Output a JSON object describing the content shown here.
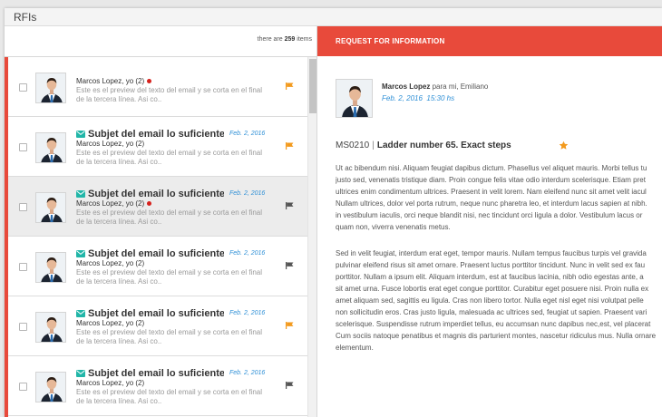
{
  "window": {
    "title": "RFIs"
  },
  "list": {
    "count_prefix": "there are",
    "count_value": "259",
    "count_suffix": "items"
  },
  "messages": [
    {
      "subject": "",
      "date": "",
      "from": "Marcos Lopez, yo (2)",
      "unread_dot": true,
      "preview": "Este es el preview del texto del email y se corta en el final de la tercera línea. Asi co..",
      "flag_color": "#f39a1d",
      "selected": false
    },
    {
      "subject": "Subjet del email lo suficientem..",
      "date": "Feb. 2, 2016",
      "from": "Marcos Lopez, yo (2)",
      "unread_dot": false,
      "preview": "Este es el preview del texto del email y se corta en el final de la tercera línea. Asi co..",
      "flag_color": "#f39a1d",
      "selected": false
    },
    {
      "subject": "Subjet del email lo suficientem..",
      "date": "Feb. 2, 2016",
      "from": "Marcos Lopez, yo (2)",
      "unread_dot": true,
      "preview": "Este es el preview del texto del email y se corta en el final de la tercera línea. Asi co..",
      "flag_color": "#555555",
      "selected": true
    },
    {
      "subject": "Subjet del email lo suficientem..",
      "date": "Feb. 2, 2016",
      "from": "Marcos Lopez, yo (2)",
      "unread_dot": false,
      "preview": "Este es el preview del texto del email y se corta en el final de la tercera línea. Asi co..",
      "flag_color": "#555555",
      "selected": false
    },
    {
      "subject": "Subjet del email lo suficientem..",
      "date": "Feb. 2, 2016",
      "from": "Marcos Lopez, yo (2)",
      "unread_dot": false,
      "preview": "Este es el preview del texto del email y se corta en el final de la tercera línea. Asi co..",
      "flag_color": "#f39a1d",
      "selected": false
    },
    {
      "subject": "Subjet del email lo suficientem..",
      "date": "Feb. 2, 2016",
      "from": "Marcos Lopez, yo (2)",
      "unread_dot": false,
      "preview": "Este es el preview del texto del email y se corta en el final de la tercera línea. Asi co..",
      "flag_color": "#555555",
      "selected": false
    }
  ],
  "detail": {
    "header": "REQUEST FOR INFORMATION",
    "sender": "Marcos Lopez",
    "recipients": "para mi, Emiliano",
    "date": "Feb. 2, 2016",
    "time": "15:30 hs",
    "code": "MS0210",
    "separator": "|",
    "title": "Ladder number 65. Exact steps",
    "starred": true,
    "paragraph1_lines": [
      "Ut ac bibendum nisi. Aliquam feugiat dapibus dictum. Phasellus vel aliquet mauris. Morbi tellus tu",
      "justo sed, venenatis tristique diam. Proin congue felis vitae odio interdum scelerisque. Etiam pret",
      "ultrices enim condimentum ultrices. Praesent in velit lorem. Nam eleifend nunc sit amet velit iacul",
      "Nullam ultrices, dolor vel porta rutrum, neque nunc pharetra leo, et interdum lacus sapien at nibh.",
      "in vestibulum iaculis, orci neque blandit nisi, nec tincidunt orci ligula a dolor. Vestibulum lacus or",
      "quam non, viverra venenatis metus."
    ],
    "paragraph2_lines": [
      "Sed in velit feugiat, interdum erat eget, tempor mauris. Nullam tempus faucibus turpis vel gravida",
      "pulvinar eleifend risus sit amet ornare. Praesent luctus porttitor tincidunt. Nunc in velit sed ex fau",
      "porttitor. Nullam a ipsum elit. Aliquam interdum, est at faucibus lacinia, nibh odio egestas ante, a",
      "sit amet urna. Fusce lobortis erat eget congue porttitor. Curabitur eget posuere nisi. Proin nulla ex",
      "amet aliquam sed, sagittis eu ligula. Cras non libero tortor. Nulla eget nisl eget nisi volutpat pelle",
      "non sollicitudin eros. Cras justo ligula, malesuada ac ultrices sed, feugiat ut sapien. Praesent vari",
      "scelerisque. Suspendisse rutrum imperdiet tellus, eu accumsan nunc dapibus nec,est, vel placerat",
      "Cum sociis natoque penatibus et magnis dis parturient montes, nascetur ridiculus mus. Nulla ornare",
      "elementum."
    ]
  },
  "colors": {
    "accent_red": "#e84a3b",
    "link_blue": "#2e8fd6",
    "flag_orange": "#f39a1d",
    "mail_icon_teal": "#21b6a8",
    "star_orange": "#f39a1d"
  },
  "icons": {
    "envelope": "envelope-icon",
    "flag": "flag-icon",
    "star": "star-icon",
    "avatar": "avatar-photo"
  }
}
